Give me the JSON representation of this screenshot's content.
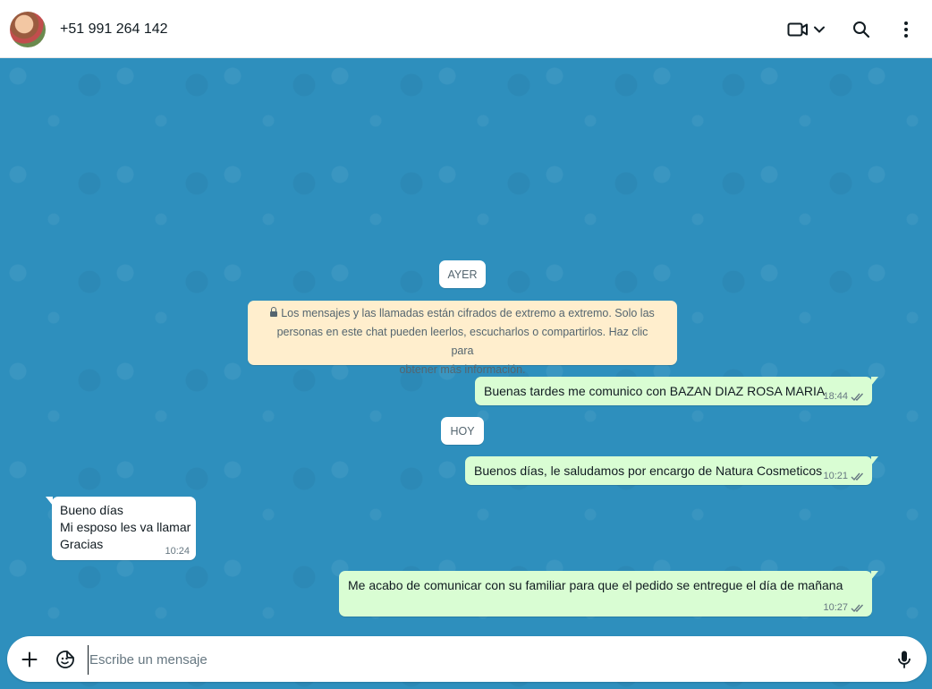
{
  "header": {
    "contact": "+51 991 264 142",
    "icons": [
      "avatar",
      "video-call-icon",
      "chevron-down-icon",
      "search-icon",
      "more-options-icon"
    ]
  },
  "chat": {
    "day_yesterday": "AYER",
    "system_message": {
      "line1": "Los mensajes y las llamadas están cifrados de extremo a extremo. Solo las",
      "line2": "personas en este chat pueden leerlos, escucharlos o compartirlos. Haz clic para",
      "line3": "obtener más información."
    },
    "msg1": {
      "text": "Buenas tardes me comunico con BAZAN DIAZ ROSA MARIA",
      "time": "18:44"
    },
    "day_today": "HOY",
    "msg2": {
      "text": "Buenos días, le saludamos por encargo de Natura Cosmeticos",
      "time": "10:21"
    },
    "msg3": {
      "line1": "Bueno días",
      "line2": "Mi esposo les va llamar",
      "line3": "Gracias",
      "time": "10:24"
    },
    "msg4": {
      "text": "Me acabo de comunicar con su familiar para que el pedido se entregue el día de mañana",
      "time": "10:27"
    }
  },
  "composer": {
    "placeholder": "Escribe un mensaje"
  },
  "colors": {
    "chat_background": "#2e8fbd",
    "outgoing_bubble": "#d9fdd3",
    "incoming_bubble": "#ffffff",
    "system_bubble": "#ffeecd",
    "read_ticks": "#667781"
  }
}
